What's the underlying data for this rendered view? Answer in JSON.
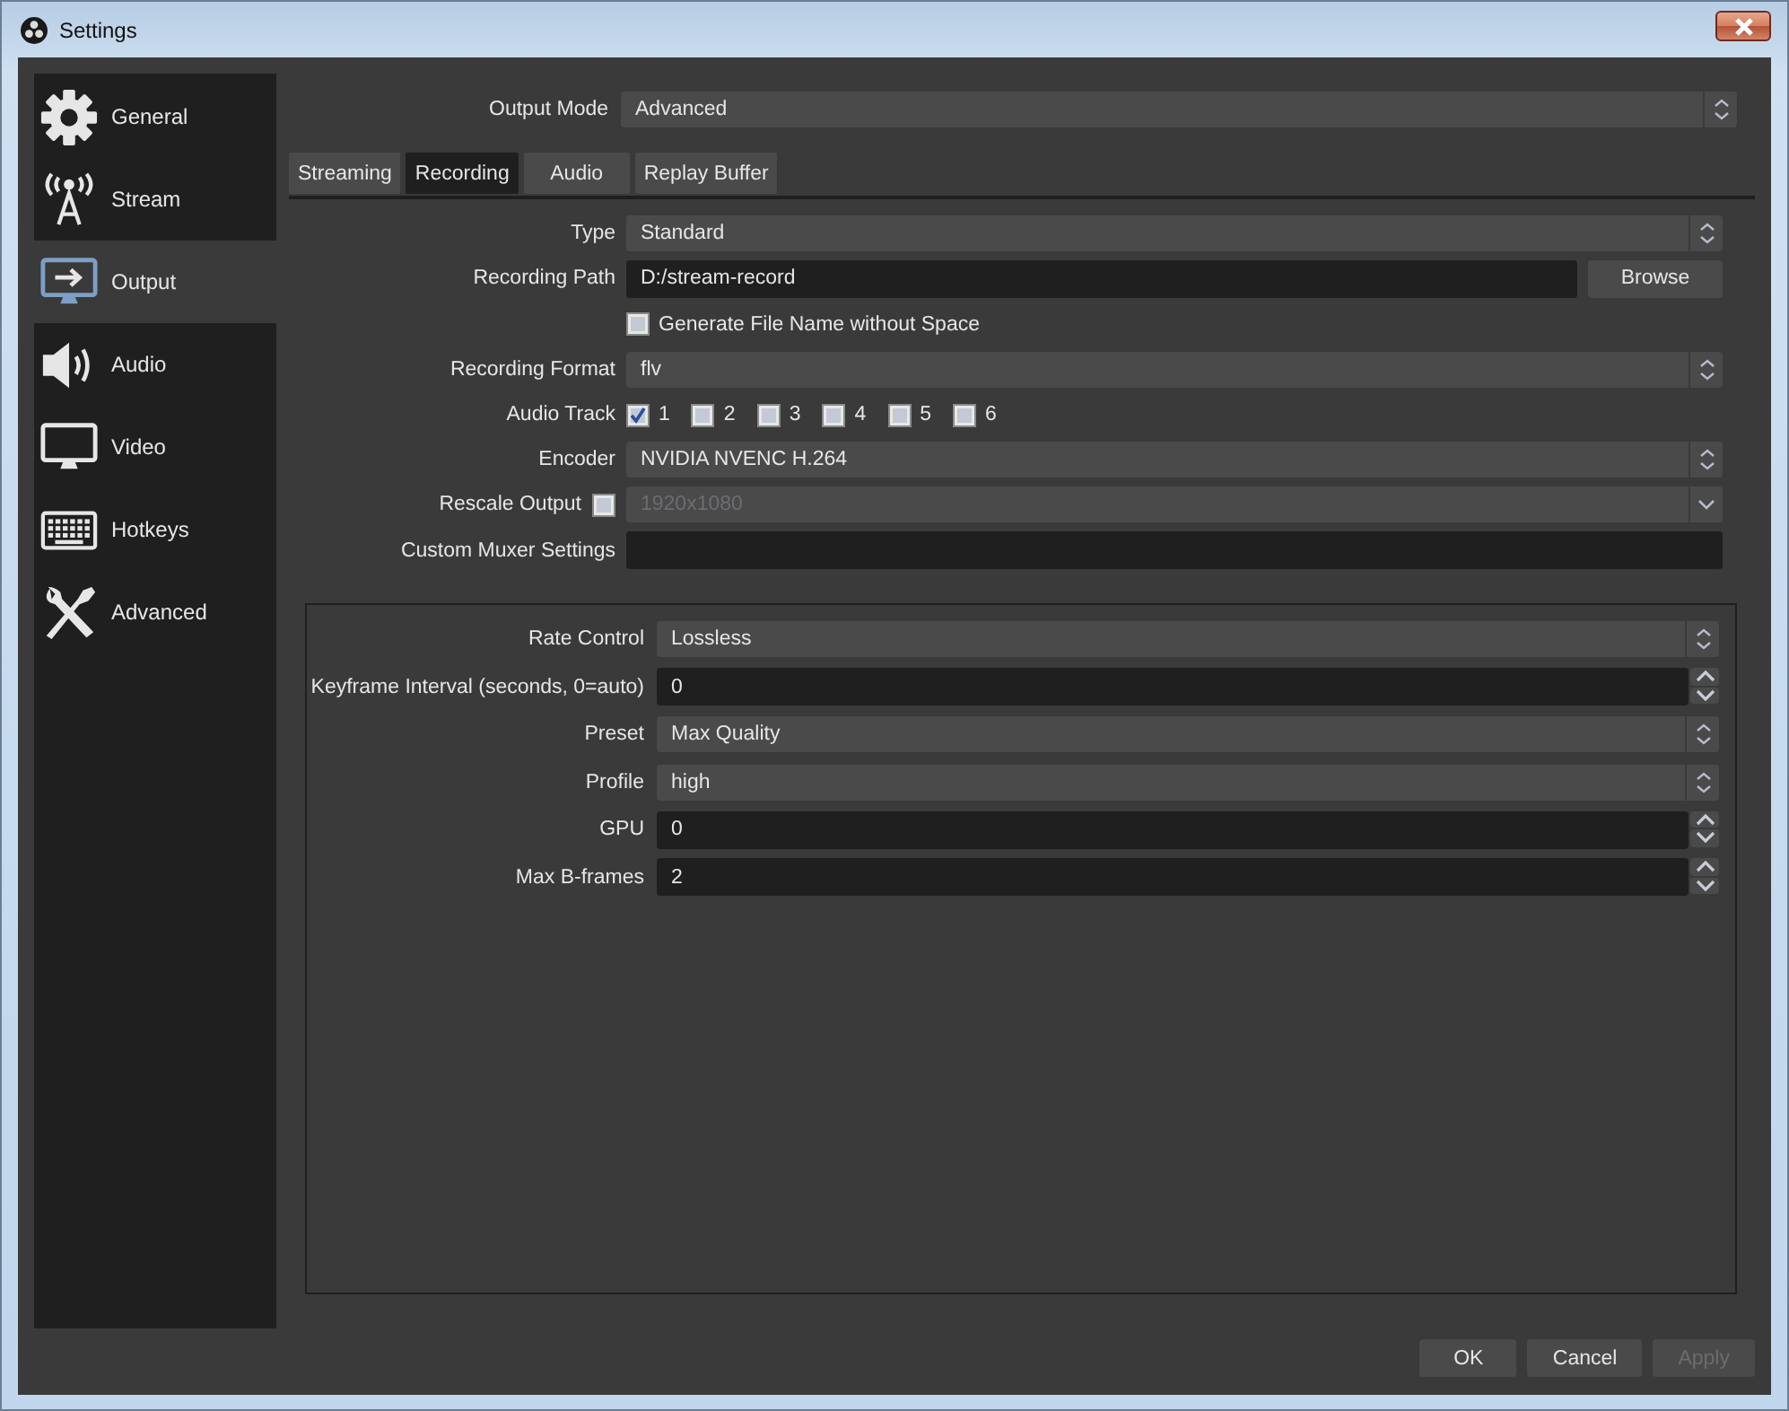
{
  "window": {
    "title": "Settings"
  },
  "sidebar": {
    "items": [
      {
        "label": "General",
        "selected": false
      },
      {
        "label": "Stream",
        "selected": false
      },
      {
        "label": "Output",
        "selected": true
      },
      {
        "label": "Audio",
        "selected": false
      },
      {
        "label": "Video",
        "selected": false
      },
      {
        "label": "Hotkeys",
        "selected": false
      },
      {
        "label": "Advanced",
        "selected": false
      }
    ]
  },
  "output_mode": {
    "label": "Output Mode",
    "value": "Advanced"
  },
  "tabs": [
    {
      "label": "Streaming",
      "selected": false
    },
    {
      "label": "Recording",
      "selected": true
    },
    {
      "label": "Audio",
      "selected": false
    },
    {
      "label": "Replay Buffer",
      "selected": false
    }
  ],
  "recording": [
    {
      "kind": "select",
      "label": "Type",
      "value": "Standard"
    },
    {
      "kind": "path",
      "label": "Recording Path",
      "value": "D:/stream-record",
      "button": "Browse"
    },
    {
      "kind": "checkbox",
      "label": "Generate File Name without Space",
      "checked": false
    },
    {
      "kind": "select",
      "label": "Recording Format",
      "value": "flv"
    },
    {
      "kind": "tracks",
      "label": "Audio Track",
      "tracks": [
        {
          "label": "1",
          "checked": true
        },
        {
          "label": "2",
          "checked": false
        },
        {
          "label": "3",
          "checked": false
        },
        {
          "label": "4",
          "checked": false
        },
        {
          "label": "5",
          "checked": false
        },
        {
          "label": "6",
          "checked": false
        }
      ]
    },
    {
      "kind": "select",
      "label": "Encoder",
      "value": "NVIDIA NVENC H.264"
    },
    {
      "kind": "rescale",
      "label": "Rescale Output",
      "checked": false,
      "value": "1920x1080",
      "disabled": true
    },
    {
      "kind": "text",
      "label": "Custom Muxer Settings"
    }
  ],
  "encoder_settings": [
    {
      "kind": "select",
      "label": "Rate Control",
      "value": "Lossless"
    },
    {
      "kind": "spin",
      "label": "Keyframe Interval (seconds, 0=auto)",
      "value": "0"
    },
    {
      "kind": "select",
      "label": "Preset",
      "value": "Max Quality"
    },
    {
      "kind": "select",
      "label": "Profile",
      "value": "high"
    },
    {
      "kind": "spin",
      "label": "GPU",
      "value": "0"
    },
    {
      "kind": "spin",
      "label": "Max B-frames",
      "value": "2"
    }
  ],
  "buttons": [
    {
      "label": "OK",
      "disabled": false
    },
    {
      "label": "Cancel",
      "disabled": false
    },
    {
      "label": "Apply",
      "disabled": true
    }
  ]
}
